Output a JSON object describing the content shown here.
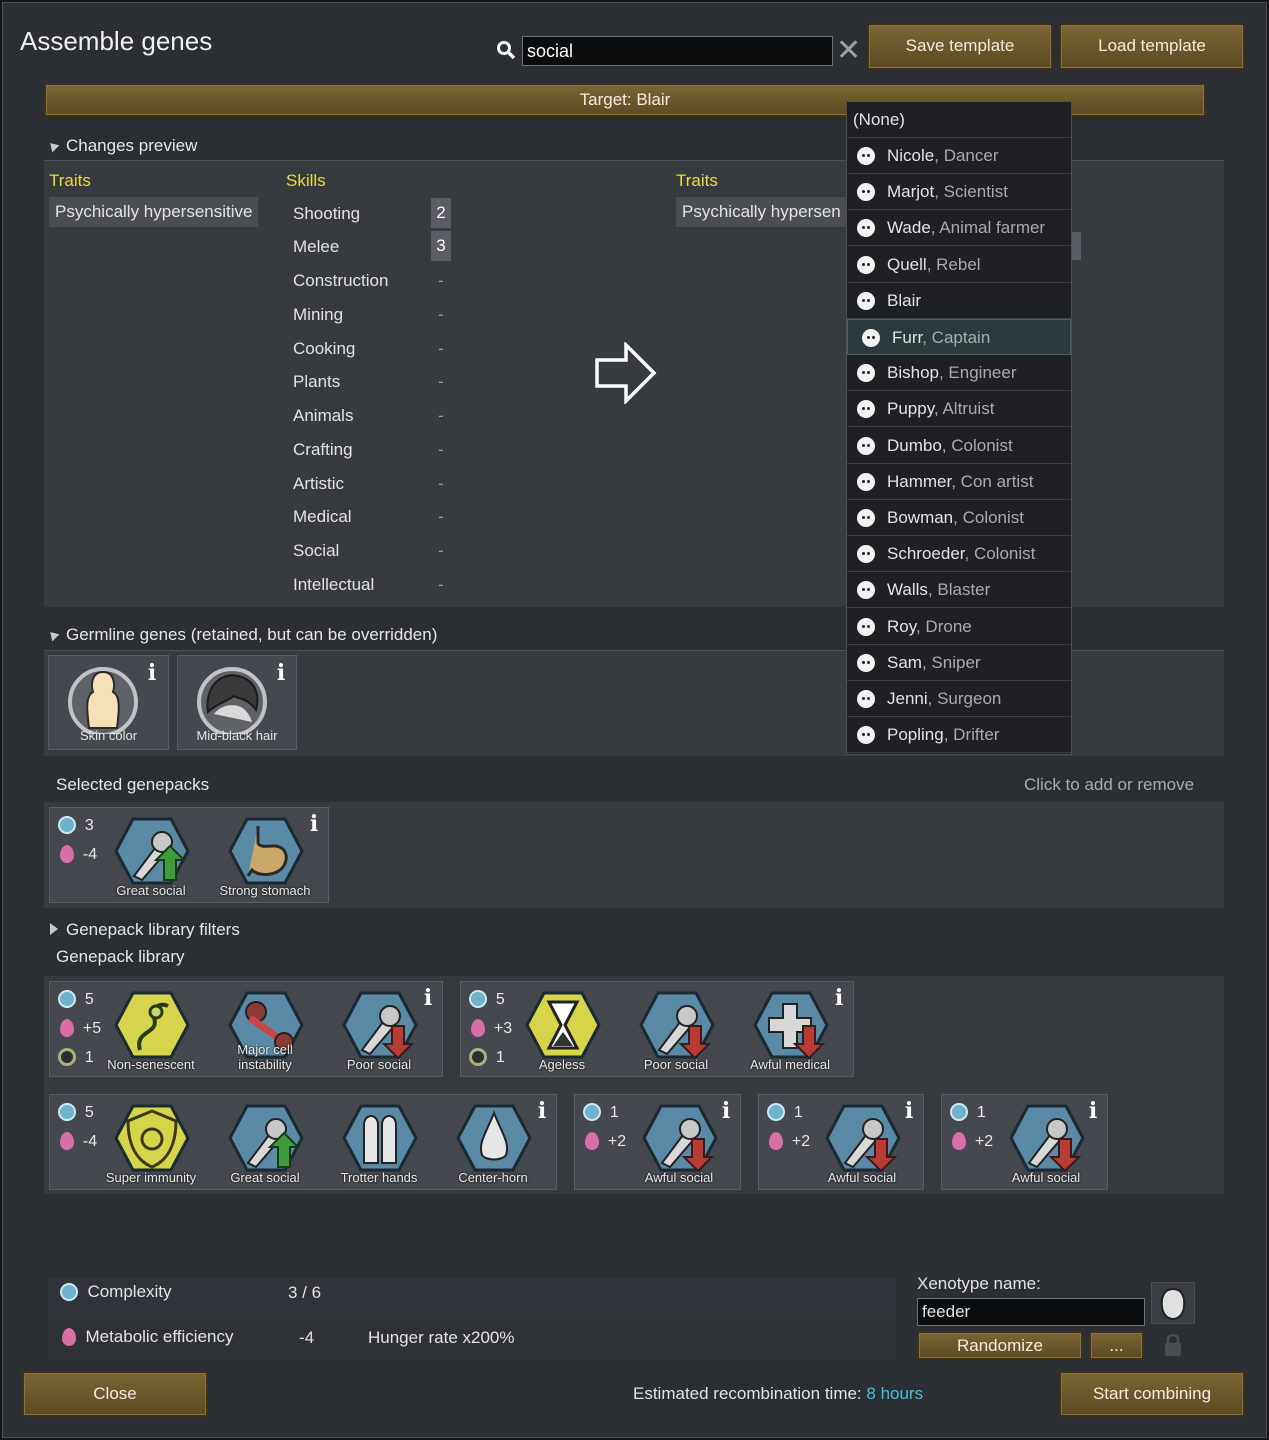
{
  "window": {
    "title": "Assemble genes"
  },
  "search": {
    "value": "social",
    "clear_icon": "close-icon"
  },
  "toolbar": {
    "save_label": "Save template",
    "load_label": "Load template"
  },
  "target": {
    "label": "Target: Blair"
  },
  "changes_preview": {
    "header": "Changes preview",
    "left": {
      "traits_header": "Traits",
      "trait": "Psychically hypersensitive",
      "skills_header": "Skills",
      "skills": [
        {
          "name": "Shooting",
          "value": "2"
        },
        {
          "name": "Melee",
          "value": "3"
        },
        {
          "name": "Construction",
          "value": "-"
        },
        {
          "name": "Mining",
          "value": "-"
        },
        {
          "name": "Cooking",
          "value": "-"
        },
        {
          "name": "Plants",
          "value": "-"
        },
        {
          "name": "Animals",
          "value": "-"
        },
        {
          "name": "Crafting",
          "value": "-"
        },
        {
          "name": "Artistic",
          "value": "-"
        },
        {
          "name": "Medical",
          "value": "-"
        },
        {
          "name": "Social",
          "value": "-"
        },
        {
          "name": "Intellectual",
          "value": "-"
        }
      ]
    },
    "right": {
      "traits_header": "Traits",
      "trait": "Psychically hypersen"
    }
  },
  "dropdown": {
    "items": [
      {
        "name": "(None)",
        "role": ""
      },
      {
        "name": "Nicole",
        "role": ", Dancer"
      },
      {
        "name": "Marjot",
        "role": ", Scientist"
      },
      {
        "name": "Wade",
        "role": ", Animal farmer"
      },
      {
        "name": "Quell",
        "role": ", Rebel"
      },
      {
        "name": "Blair",
        "role": ""
      },
      {
        "name": "Furr",
        "role": ", Captain"
      },
      {
        "name": "Bishop",
        "role": ", Engineer"
      },
      {
        "name": "Puppy",
        "role": ", Altruist"
      },
      {
        "name": "Dumbo",
        "role": ", Colonist"
      },
      {
        "name": "Hammer",
        "role": ", Con artist"
      },
      {
        "name": "Bowman",
        "role": ", Colonist"
      },
      {
        "name": "Schroeder",
        "role": ", Colonist"
      },
      {
        "name": "Walls",
        "role": ", Blaster"
      },
      {
        "name": "Roy",
        "role": ", Drone"
      },
      {
        "name": "Sam",
        "role": ", Sniper"
      },
      {
        "name": "Jenni",
        "role": ", Surgeon"
      },
      {
        "name": "Popling",
        "role": ", Drifter"
      }
    ]
  },
  "germline": {
    "header": "Germline genes (retained, but can be overridden)",
    "genes": [
      "Skin color",
      "Mid-black hair"
    ]
  },
  "selected": {
    "header": "Selected genepacks",
    "hint": "Click to add or remove",
    "pack": {
      "complexity": "3",
      "metabolic": "-4",
      "genes": [
        "Great social",
        "Strong stomach"
      ]
    }
  },
  "library": {
    "filters_header": "Genepack library filters",
    "header": "Genepack library",
    "row1": [
      {
        "complexity": "5",
        "metabolic": "+5",
        "archite": "1",
        "genes": [
          "Non-senescent",
          "Major cell instability",
          "Poor social"
        ]
      },
      {
        "complexity": "5",
        "metabolic": "+3",
        "archite": "1",
        "genes": [
          "Ageless",
          "Poor social",
          "Awful medical"
        ]
      }
    ],
    "row2": [
      {
        "complexity": "5",
        "metabolic": "-4",
        "genes": [
          "Super immunity",
          "Great social",
          "Trotter hands",
          "Center-horn"
        ]
      },
      {
        "complexity": "1",
        "metabolic": "+2",
        "genes": [
          "Awful social"
        ]
      },
      {
        "complexity": "1",
        "metabolic": "+2",
        "genes": [
          "Awful social"
        ]
      },
      {
        "complexity": "1",
        "metabolic": "+2",
        "genes": [
          "Awful social"
        ]
      }
    ]
  },
  "summary": {
    "complexity_label": "Complexity",
    "complexity_value": "3 / 6",
    "metabolic_label": "Metabolic efficiency",
    "metabolic_value": "-4",
    "metabolic_effect": "Hunger rate x200%"
  },
  "xenotype": {
    "label": "Xenotype name:",
    "value": "feeder",
    "randomize_label": "Randomize",
    "more_label": "..."
  },
  "footer": {
    "close_label": "Close",
    "estimate_label": "Estimated recombination time: ",
    "estimate_value": "8 hours",
    "start_label": "Start combining"
  },
  "colors": {
    "accent_yellow": "#e8dd3a",
    "button_brown": "#6b5729",
    "time_cyan": "#46c2d6"
  }
}
